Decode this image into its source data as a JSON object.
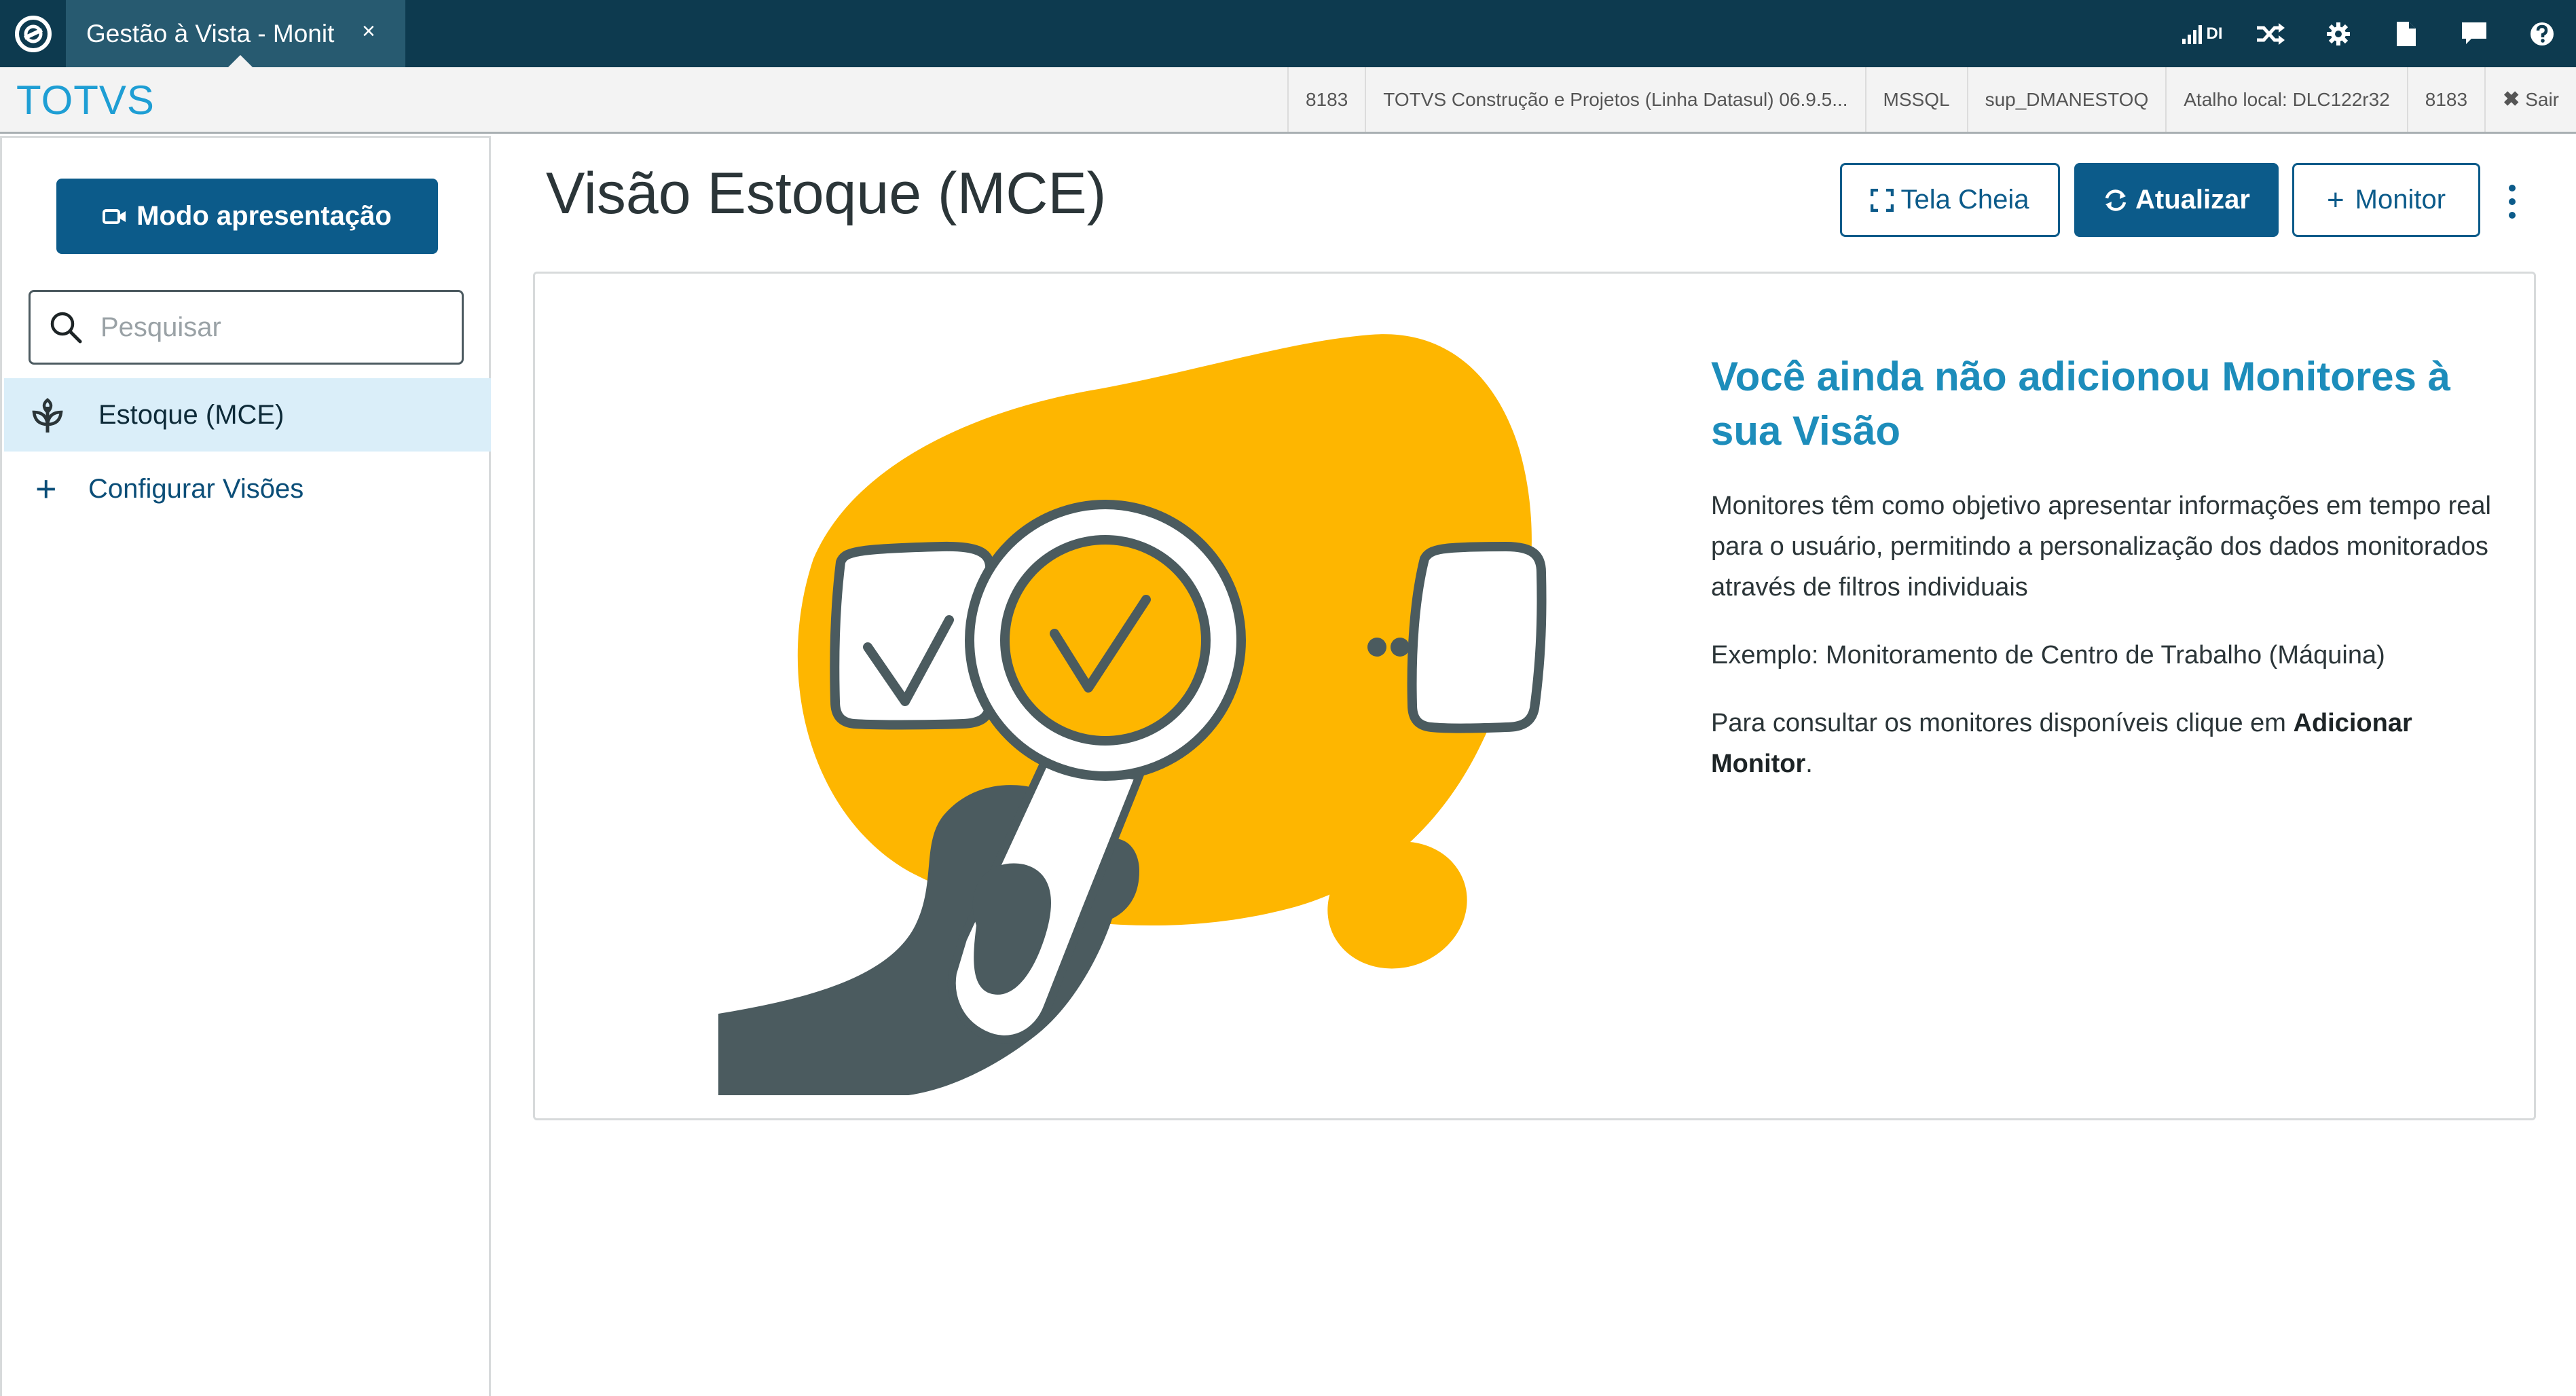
{
  "tab": {
    "title": "Gestão à Vista - Monit",
    "close": "×"
  },
  "topbar": {
    "signal_label": "DI",
    "icons": [
      "signal-icon",
      "shuffle-icon",
      "gear-icon",
      "document-icon",
      "chat-icon",
      "help-icon"
    ]
  },
  "infobar": {
    "brand": "TOTVS",
    "items": [
      "8183",
      "TOTVS Construção e Projetos (Linha Datasul) 06.9.5...",
      "MSSQL",
      "sup_DMANESTOQ",
      "Atalho local: DLC122r32",
      "8183"
    ],
    "exit_label": "Sair"
  },
  "sidebar": {
    "present_button": "Modo apresentação",
    "search_placeholder": "Pesquisar",
    "items": [
      {
        "label": "Estoque (MCE)",
        "icon": "sprout-icon",
        "active": true
      },
      {
        "label": "Configurar Visões",
        "icon": "plus-icon",
        "active": false
      }
    ]
  },
  "main": {
    "title": "Visão Estoque (MCE)",
    "buttons": {
      "fullscreen": "Tela Cheia",
      "refresh": "Atualizar",
      "monitor": "Monitor"
    }
  },
  "empty_state": {
    "title": "Você ainda não adicionou Monitores à sua Visão",
    "paragraph1": "Monitores têm como objetivo apresentar informações em tempo real para o usuário, permitindo a personalização dos dados monitorados através de filtros individuais",
    "paragraph2": "Exemplo: Monitoramento de Centro de Trabalho (Máquina)",
    "paragraph3_prefix": "Para consultar os monitores disponíveis clique em ",
    "paragraph3_bold": "Adicionar Monitor",
    "paragraph3_suffix": "."
  },
  "colors": {
    "topbar": "#0d3a4f",
    "primary": "#0c5b8a",
    "accent_blue": "#1d8dbb",
    "illustration_yellow": "#feb600",
    "illustration_gray": "#4b5b5f"
  }
}
